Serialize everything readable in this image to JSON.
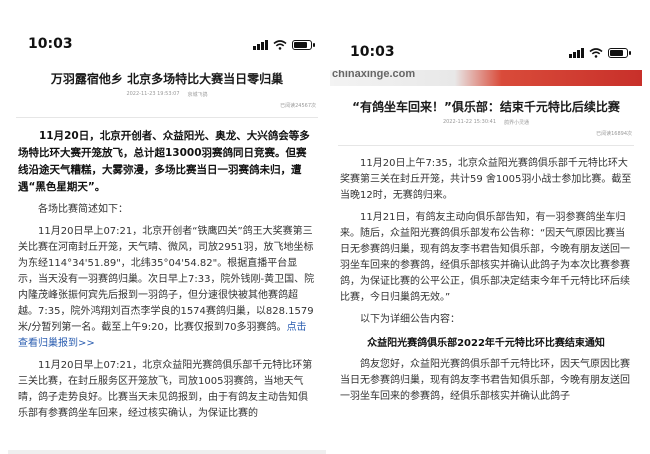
{
  "left": {
    "status": {
      "time": "10:03"
    },
    "article": {
      "title": "万羽露宿他乡 北京多场特比大赛当日零归巢",
      "date": "2022-11-23 19:53:07",
      "source": "京城飞鸽",
      "reads": "已阅读24567次",
      "lead": "11月20日，北京开创者、众益阳光、奥龙、大兴鸽会等多场特比环大赛开笼放飞，总计超13000羽赛鸽同日竞赛。但赛线沿途天气糟糕，大雾弥漫，多场比赛当日一羽赛鸽未归，遭遇“黑色星期天”。",
      "intro": "各场比赛简述如下：",
      "p1": "11月20日早上07:21，北京开创者“铁鹰四关”鸽王大奖赛第三关比赛在河南封丘开笼，天气晴、微风，司放2951羽，放飞地坐标为东经114°34'51.89\"，北纬35°04'54.82\"。根据直播平台显示，当天没有一羽赛鸽归巢。次日早上7:33，院外钱刚-黄卫国、院内隆茂峰张振何宾先后报到一羽鸽子，但分速很快被其他赛鸽超越。7:35，院外鸿翔刘百杰李学良的1574赛鸽归巢，以828.1579米/分暂列第一名。截至上午9:20，比赛仅报到70多羽赛鸽。",
      "p1_link": "点击查看归巢报到>>",
      "p2": "11月20日早上07:21，北京众益阳光赛鸽俱乐部千元特比环第三关比赛，在封丘服务区开笼放飞，司放1005羽赛鸽，当地天气晴，鸽子走势良好。比赛当天未见鸽报到，由于有鸽友主动告知俱乐部有参赛鸽坐车回来，经过核实确认，为保证比赛的"
    }
  },
  "right": {
    "status": {
      "time": "10:03"
    },
    "banner": {
      "site": "chinaxinge.com"
    },
    "article": {
      "title": "“有鸽坐车回来！”俱乐部：结束千元特比后续比赛",
      "date": "2022-11-22 15:30:41",
      "source": "鸽界小灵通",
      "reads": "已阅读16894次",
      "p1": "11月20日上午7:35，北京众益阳光赛鸽俱乐部千元特比环大奖赛第三关在封丘开笼，共计59 舍1005羽小战士参加比赛。截至当晚12时，无赛鸽归来。",
      "p2": "11月21日，有鸽友主动向俱乐部告知，有一羽参赛鸽坐车归来。随后，众益阳光赛鸽俱乐部发布公告称：“因天气原因比赛当日无参赛鸽归巢，现有鸽友李书君告知俱乐部，今晚有朋友送回一羽坐车回来的参赛鸽，经俱乐部核实并确认此鸽子为本次比赛参赛鸽，为保证比赛的公平公正，俱乐部决定结束今年千元特比环后续比赛，今日归巢鸽无效。”",
      "p3": "以下为详细公告内容：",
      "notice_title": "众益阳光赛鸽俱乐部2022年千元特比环比赛结束通知",
      "p4": "鸽友您好，众益阳光赛鸽俱乐部千元特比环，因天气原因比赛当日无参赛鸽归巢，现有鸽友李书君告知俱乐部，今晚有朋友送回一羽坐车回来的参赛鸽，经俱乐部核实并确认此鸽子"
    }
  }
}
